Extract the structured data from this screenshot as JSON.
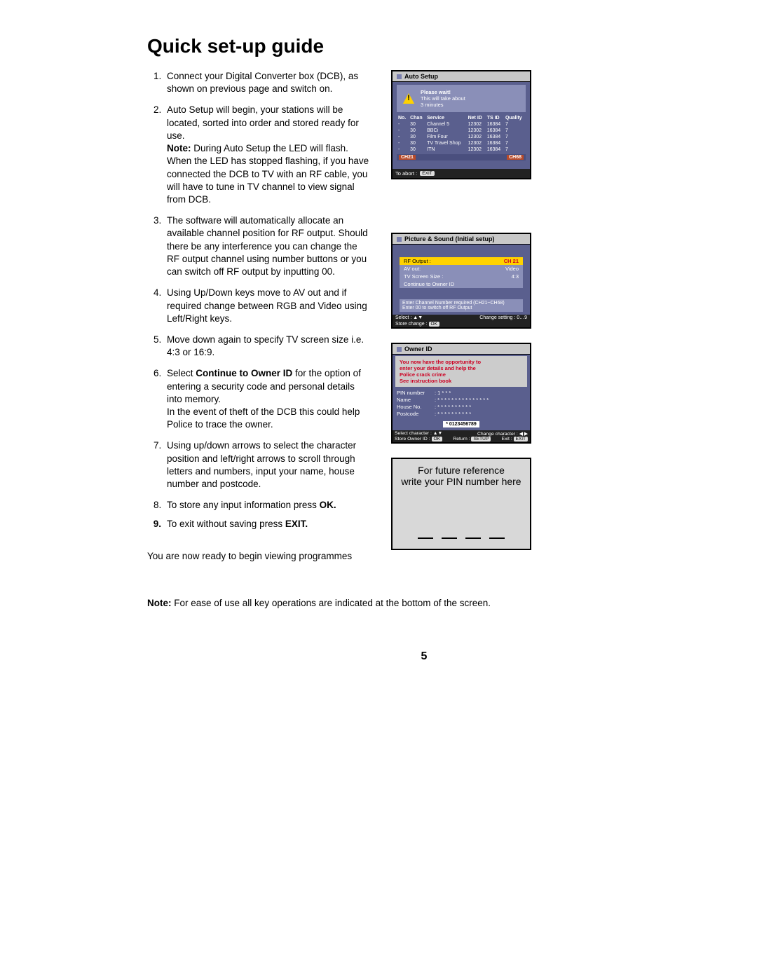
{
  "title": "Quick set-up guide",
  "steps": {
    "s1": "Connect your Digital Converter box (DCB), as shown on previous page and switch on.",
    "s2a": "Auto Setup will begin, your stations will be located, sorted into order and stored ready for use.",
    "s2_note_label": "Note:",
    "s2b": " During Auto Setup the LED will flash. When the LED has stopped flashing, if you have connected the DCB to TV with an RF cable, you will have to tune in TV channel to view signal from DCB.",
    "s3": "The software will automatically allocate an available channel position for RF output. Should there be any interference you can change the RF output channel using number buttons or you can switch off RF output by inputting 00.",
    "s4": "Using Up/Down keys move to AV out and if required change between RGB and Video using Left/Right keys.",
    "s5": "Move down again to specify TV screen size i.e. 4:3 or 16:9.",
    "s6a": "Select ",
    "s6_bold": "Continue to Owner ID",
    "s6b": " for the option of entering a security code and personal details into memory.",
    "s6c": "In the event of theft of the DCB this could help Police to trace the owner.",
    "s7": "Using up/down arrows to select the character position and left/right arrows to scroll through letters and numbers, input your name, house number and postcode.",
    "s8a": "To store any input information press ",
    "s8_bold": "OK.",
    "s9_num": "9.",
    "s9a": "To exit without saving press ",
    "s9_bold": "EXIT."
  },
  "ready": "You are now ready to begin viewing programmes",
  "bottom_note_label": "Note:",
  "bottom_note": " For ease of use all key operations are indicated at the bottom of the screen.",
  "page_number": "5",
  "osd_auto": {
    "title": "Auto Setup",
    "msg1": "Please wait!",
    "msg2": "This will take about",
    "msg3": "3 minutes",
    "headers": [
      "No.",
      "Chan",
      "Service",
      "Net ID",
      "TS ID",
      "Quality"
    ],
    "rows": [
      [
        "-",
        "30",
        "Channel 5",
        "12302",
        "16384",
        "7"
      ],
      [
        "-",
        "30",
        "BBCi",
        "12302",
        "16384",
        "7"
      ],
      [
        "-",
        "30",
        "Film Four",
        "12302",
        "16384",
        "7"
      ],
      [
        "-",
        "30",
        "TV Travel Shop",
        "12302",
        "16384",
        "7"
      ],
      [
        "-",
        "30",
        "ITN",
        "12302",
        "16384",
        "7"
      ]
    ],
    "slider_left": "CH21",
    "slider_right": "CH68",
    "abort_label": "To abort :",
    "abort_key": "EXIT"
  },
  "osd_pic": {
    "title": "Picture & Sound (Initial setup)",
    "rows": [
      {
        "label": "RF Output :",
        "value": "CH 21",
        "hl": true
      },
      {
        "label": "AV out:",
        "value": "Video"
      },
      {
        "label": "TV Screen Size :",
        "value": "4:3"
      },
      {
        "label": "Continue to Owner ID",
        "value": ""
      }
    ],
    "hint1": "Enter Channel Number required (CH21~CH68)",
    "hint2": "Enter 00 to switch off RF Output",
    "foot_select": "Select : ▲▼",
    "foot_change": "Change setting : 0…9",
    "foot_store": "Store change :",
    "foot_store_key": "OK"
  },
  "osd_owner": {
    "title": "Owner ID",
    "msg1": "You now have the opportunity to",
    "msg2": "enter your details and help the",
    "msg3": "Police crack crime",
    "msg4": "See instruction book",
    "fields": [
      {
        "label": "PIN number",
        "value": ": 1 * * *"
      },
      {
        "label": "Name",
        "value": ": * * * * * * * * * * * * * * *"
      },
      {
        "label": "House No.",
        "value": ": * * * * * * * * * *"
      },
      {
        "label": "Postcode",
        "value": ": * * * * * * * * * *"
      }
    ],
    "numstrip": "* 0123456789",
    "foot1_l": "Select character : ▲▼",
    "foot1_r": "Change character : ◀ ▶",
    "foot2_store": "Store Owner ID :",
    "foot2_store_key": "OK",
    "foot2_return": "Return :",
    "foot2_return_key": "SETUP",
    "foot2_exit": "Exit :",
    "foot2_exit_key": "EXIT"
  },
  "pinbox": {
    "line1": "For future reference",
    "line2": "write your PIN number here"
  }
}
